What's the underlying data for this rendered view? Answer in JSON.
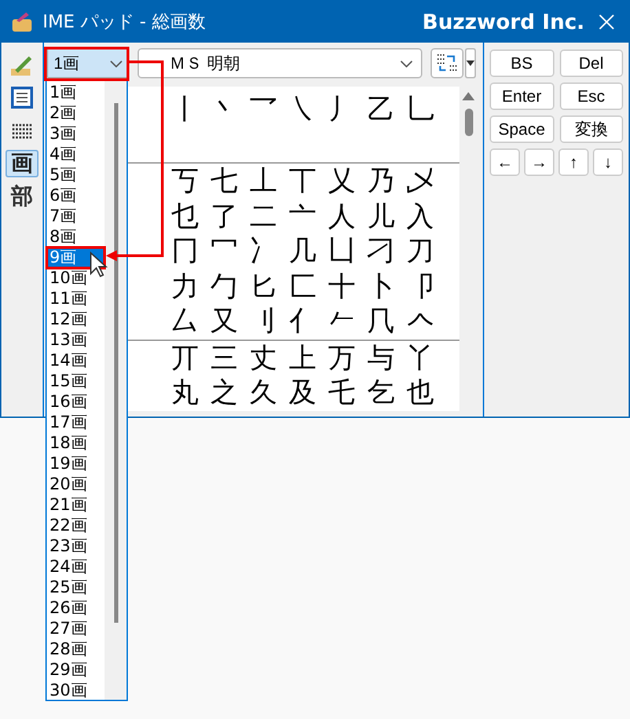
{
  "window": {
    "title": "IME パッド - 総画数",
    "brand": "Buzzword Inc."
  },
  "tools": [
    {
      "kind": "pen",
      "selected": false
    },
    {
      "kind": "grid",
      "selected": false
    },
    {
      "kind": "keyboard",
      "selected": false
    },
    {
      "kind": "glyph",
      "label": "画",
      "selected": true
    },
    {
      "kind": "glyph",
      "label": "部",
      "selected": false
    }
  ],
  "stroke_combo": {
    "value": "1画",
    "expanded": true
  },
  "stroke_list": [
    {
      "label": "1画",
      "selected": false
    },
    {
      "label": "2画",
      "selected": false
    },
    {
      "label": "3画",
      "selected": false
    },
    {
      "label": "4画",
      "selected": false
    },
    {
      "label": "5画",
      "selected": false
    },
    {
      "label": "6画",
      "selected": false
    },
    {
      "label": "7画",
      "selected": false
    },
    {
      "label": "8画",
      "selected": false
    },
    {
      "label": "9画",
      "selected": true
    },
    {
      "label": "10画",
      "selected": false
    },
    {
      "label": "11画",
      "selected": false
    },
    {
      "label": "12画",
      "selected": false
    },
    {
      "label": "13画",
      "selected": false
    },
    {
      "label": "14画",
      "selected": false
    },
    {
      "label": "15画",
      "selected": false
    },
    {
      "label": "16画",
      "selected": false
    },
    {
      "label": "17画",
      "selected": false
    },
    {
      "label": "18画",
      "selected": false
    },
    {
      "label": "19画",
      "selected": false
    },
    {
      "label": "20画",
      "selected": false
    },
    {
      "label": "21画",
      "selected": false
    },
    {
      "label": "22画",
      "selected": false
    },
    {
      "label": "23画",
      "selected": false
    },
    {
      "label": "24画",
      "selected": false
    },
    {
      "label": "25画",
      "selected": false
    },
    {
      "label": "26画",
      "selected": false
    },
    {
      "label": "27画",
      "selected": false
    },
    {
      "label": "28画",
      "selected": false
    },
    {
      "label": "29画",
      "selected": false
    },
    {
      "label": "30画",
      "selected": false
    }
  ],
  "font_combo": {
    "value": "ＭＳ 明朝"
  },
  "char_groups": [
    {
      "rows": [
        [
          "丨",
          "丶",
          "乛",
          "㇏",
          "丿",
          "乙",
          "乚"
        ],
        []
      ]
    },
    {
      "rows": [
        [
          "丂",
          "七",
          "丄",
          "丅",
          "乂",
          "乃",
          "乄"
        ],
        [
          "乜",
          "了",
          "二",
          "亠",
          "人",
          "儿",
          "入"
        ],
        [
          "冂",
          "冖",
          "冫",
          "几",
          "凵",
          "刁",
          "刀"
        ],
        [
          "力",
          "勹",
          "匕",
          "匚",
          "十",
          "卜",
          "卩"
        ],
        [
          "厶",
          "又",
          "刂",
          "亻",
          "𠂉",
          "⺇",
          "𠆢"
        ]
      ]
    },
    {
      "rows": [
        [
          "丌",
          "三",
          "丈",
          "上",
          "万",
          "与",
          "丫"
        ],
        [
          "丸",
          "之",
          "久",
          "及",
          "乇",
          "乞",
          "也"
        ]
      ]
    }
  ],
  "keys": [
    {
      "label": "BS"
    },
    {
      "label": "Del"
    },
    {
      "label": "Enter"
    },
    {
      "label": "Esc"
    },
    {
      "label": "Space"
    },
    {
      "label": "変換"
    }
  ],
  "arrow_keys": [
    {
      "label": "←"
    },
    {
      "label": "→"
    },
    {
      "label": "↑"
    },
    {
      "label": "↓"
    }
  ]
}
